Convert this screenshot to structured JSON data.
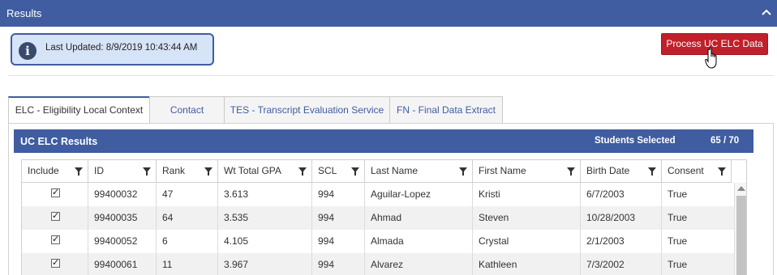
{
  "header": {
    "title": "Results",
    "collapse_icon": "chevron-up-icon"
  },
  "status": {
    "last_updated": "Last Updated: 8/9/2019 10:43:44 AM",
    "icon": "info-icon"
  },
  "actions": {
    "process_label": "Process UC ELC Data"
  },
  "tabs": [
    {
      "label": "ELC - Eligibility Local Context",
      "active": true
    },
    {
      "label": "Contact",
      "active": false
    },
    {
      "label": "TES - Transcript Evaluation Service",
      "active": false
    },
    {
      "label": "FN - Final Data Extract",
      "active": false
    }
  ],
  "results": {
    "title": "UC ELC Results",
    "students_selected_label": "Students Selected",
    "selected_count": "65 / 70"
  },
  "table": {
    "columns": [
      "Include",
      "ID",
      "Rank",
      "Wt Total GPA",
      "SCL",
      "Last Name",
      "First Name",
      "Birth Date",
      "Consent"
    ],
    "rows": [
      {
        "include": true,
        "id": "99400032",
        "rank": "47",
        "gpa": "3.613",
        "scl": "994",
        "last": "Aguilar-Lopez",
        "first": "Kristi",
        "birth": "6/7/2003",
        "consent": "True"
      },
      {
        "include": true,
        "id": "99400035",
        "rank": "64",
        "gpa": "3.535",
        "scl": "994",
        "last": "Ahmad",
        "first": "Steven",
        "birth": "10/28/2003",
        "consent": "True"
      },
      {
        "include": true,
        "id": "99400052",
        "rank": "6",
        "gpa": "4.105",
        "scl": "994",
        "last": "Almada",
        "first": "Crystal",
        "birth": "2/1/2003",
        "consent": "True"
      },
      {
        "include": true,
        "id": "99400061",
        "rank": "11",
        "gpa": "3.967",
        "scl": "994",
        "last": "Alvarez",
        "first": "Kathleen",
        "birth": "7/3/2002",
        "consent": "True"
      }
    ]
  }
}
